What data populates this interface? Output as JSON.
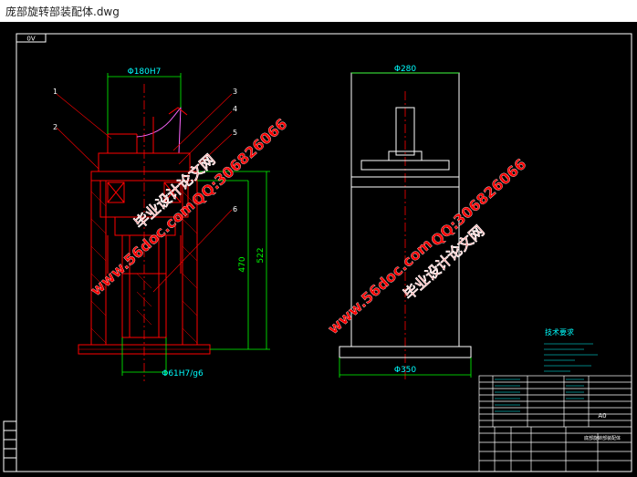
{
  "window": {
    "title": "庞部旋转部装配体.dwg"
  },
  "drawing": {
    "corner_tag": "0V",
    "dims": {
      "d180": "Φ180H7",
      "d280": "Φ280",
      "d61": "Φ61H7/g6",
      "d350": "Φ350",
      "h470": "470",
      "h522": "522"
    },
    "balloons": [
      "1",
      "2",
      "3",
      "4",
      "5",
      "6"
    ],
    "tech_title": "技术要求",
    "watermarks": {
      "site": "www.56doc.com",
      "org": "毕业设计论文网",
      "qq": "QQ:306826066"
    },
    "title_block": {
      "drawing_name": "底部旋转部装配体",
      "sheet": "A0"
    }
  },
  "colors": {
    "background": "#000000",
    "frame": "#ffffff",
    "outline": "#ff0000",
    "dimension": "#00ff00",
    "centerline": "#ff0000",
    "cyan_text": "#00ffff",
    "watermark": "#ff0000"
  }
}
